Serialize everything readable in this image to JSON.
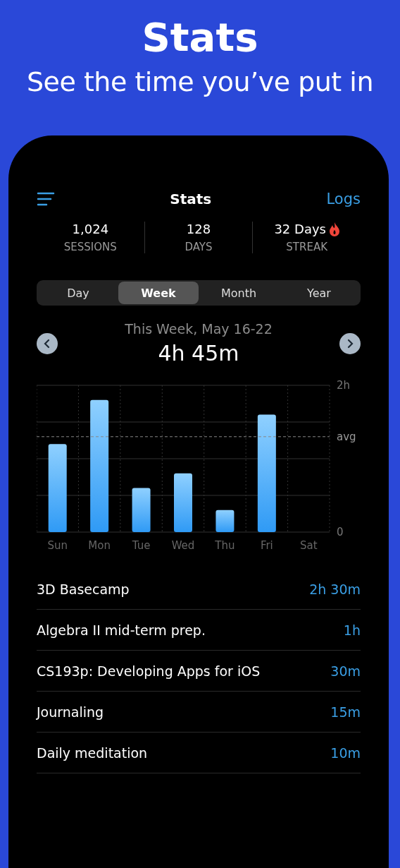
{
  "headline": {
    "title": "Stats",
    "subtitle": "See the time you’ve put in"
  },
  "nav": {
    "title": "Stats",
    "action": "Logs"
  },
  "summary": [
    {
      "value": "1,024",
      "label": "SESSIONS",
      "kind": "count"
    },
    {
      "value": "128",
      "label": "DAYS",
      "kind": "count"
    },
    {
      "value": "32 Days",
      "label": "STREAK",
      "kind": "streak"
    }
  ],
  "segments": [
    {
      "label": "Day",
      "selected": false
    },
    {
      "label": "Week",
      "selected": true
    },
    {
      "label": "Month",
      "selected": false
    },
    {
      "label": "Year",
      "selected": false
    }
  ],
  "period": {
    "label": "This Week, May 16-22",
    "total": "4h 45m"
  },
  "chart_data": {
    "type": "bar",
    "categories": [
      "Sun",
      "Mon",
      "Tue",
      "Wed",
      "Thu",
      "Fri",
      "Sat"
    ],
    "values": [
      1.2,
      1.8,
      0.6,
      0.8,
      0.3,
      1.6,
      null
    ],
    "ylim": [
      0,
      2
    ],
    "yticks": [
      {
        "value": 0,
        "label": "0"
      },
      {
        "value": 2,
        "label": "2h"
      }
    ],
    "ref_lines": [
      {
        "axis": "y",
        "value": 1.3,
        "label": "avg"
      }
    ]
  },
  "activities": [
    {
      "name": "3D Basecamp",
      "time": "2h 30m"
    },
    {
      "name": "Algebra II mid-term prep.",
      "time": "1h"
    },
    {
      "name": "CS193p: Developing Apps for iOS",
      "time": "30m"
    },
    {
      "name": "Journaling",
      "time": "15m"
    },
    {
      "name": "Daily meditation",
      "time": "10m"
    }
  ]
}
